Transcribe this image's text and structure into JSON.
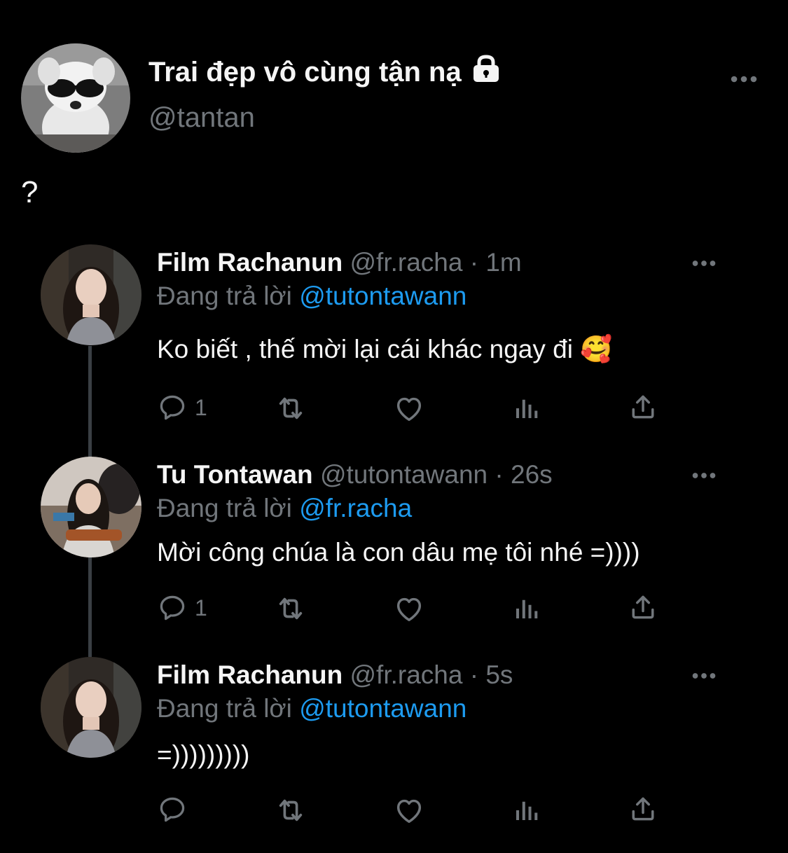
{
  "header": {
    "display_name": "Trai đẹp vô cùng tận nạ",
    "handle": "@tantan",
    "lock_icon": "lock-icon",
    "more_icon": "more-icon"
  },
  "original_tweet": {
    "text": "?"
  },
  "replies": [
    {
      "name": "Film Rachanun",
      "handle": "@fr.racha",
      "sep": "·",
      "time": "1m",
      "replying_label": "Đang trả lời",
      "replying_to": "@tutontawann",
      "text": "Ko biết , thế mời lại cái khác ngay đi",
      "emoji": "🥰",
      "reply_count": "1"
    },
    {
      "name": "Tu Tontawan",
      "handle": "@tutontawann",
      "sep": "·",
      "time": "26s",
      "replying_label": "Đang trả lời",
      "replying_to": "@fr.racha",
      "text": "Mời công chúa là con dâu mẹ tôi nhé =))))",
      "reply_count": "1"
    },
    {
      "name": "Film Rachanun",
      "handle": "@fr.racha",
      "sep": "·",
      "time": "5s",
      "replying_label": "Đang trả lời",
      "replying_to": "@tutontawann",
      "text": "=)))))))))",
      "reply_count": ""
    }
  ],
  "colors": {
    "background": "#000000",
    "text": "#f5f5f5",
    "muted": "#71767b",
    "link": "#1d9bf0",
    "thread_line": "#3a3f44"
  }
}
